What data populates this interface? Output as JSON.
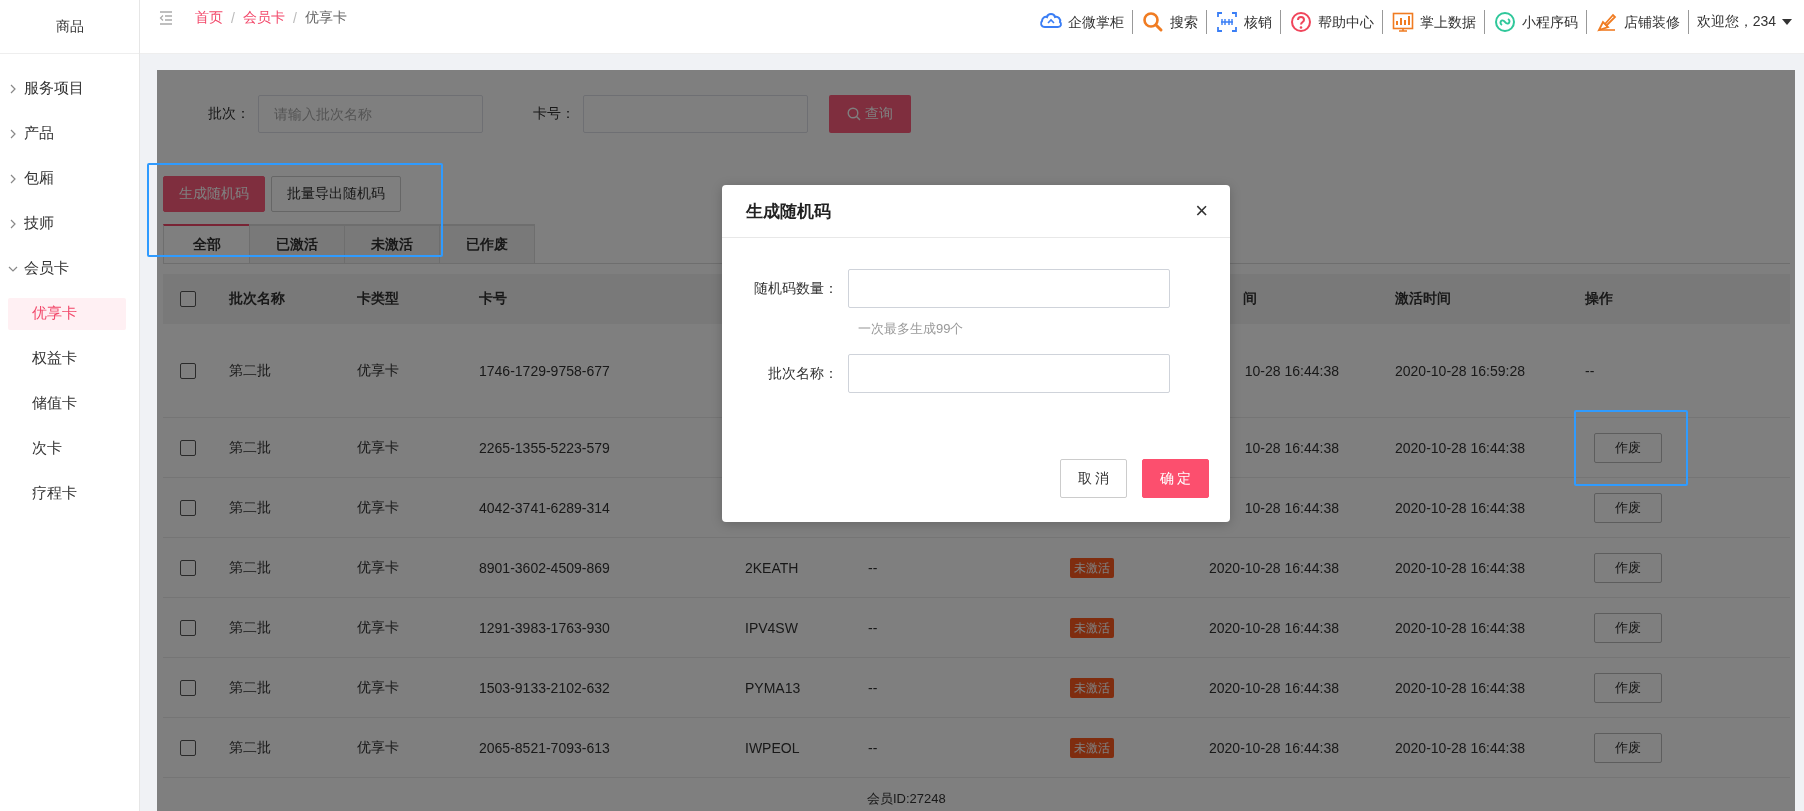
{
  "sidebar": {
    "title": "商品",
    "items": [
      {
        "label": "服务项目",
        "expanded": false
      },
      {
        "label": "产品",
        "expanded": false
      },
      {
        "label": "包厢",
        "expanded": false
      },
      {
        "label": "技师",
        "expanded": false
      },
      {
        "label": "会员卡",
        "expanded": true,
        "children": [
          {
            "label": "优享卡",
            "selected": true
          },
          {
            "label": "权益卡",
            "selected": false
          },
          {
            "label": "储值卡",
            "selected": false
          },
          {
            "label": "次卡",
            "selected": false
          },
          {
            "label": "疗程卡",
            "selected": false
          }
        ]
      }
    ]
  },
  "breadcrumb": [
    {
      "label": "首页",
      "current": false
    },
    {
      "separator": "/",
      "label": "会员卡",
      "current": false
    },
    {
      "separator": "/",
      "label": "优享卡",
      "current": true
    }
  ],
  "header_links": [
    {
      "label": "企微掌柜",
      "kind": "cloud"
    },
    {
      "label": "搜索",
      "kind": "search"
    },
    {
      "label": "核销",
      "kind": "scan"
    },
    {
      "label": "帮助中心",
      "kind": "help"
    },
    {
      "label": "掌上数据",
      "kind": "chart"
    },
    {
      "label": "小程序码",
      "kind": "link"
    },
    {
      "label": "店铺装修",
      "kind": "brush"
    }
  ],
  "user_menu": {
    "label": "欢迎您，234"
  },
  "filters": [
    {
      "label": "批次：",
      "placeholder": "请输入批次名称"
    },
    {
      "label": "卡号："
    }
  ],
  "search_button": "查询",
  "actions": [
    {
      "label": "生成随机码",
      "kind": "primary"
    },
    {
      "label": "批量导出随机码",
      "kind": "default"
    }
  ],
  "tabs": [
    {
      "label": "全部",
      "selected": true
    },
    {
      "label": "已激活",
      "selected": false
    },
    {
      "label": "未激活",
      "selected": false
    },
    {
      "label": "已作废",
      "selected": false
    }
  ],
  "table": {
    "header": {
      "checked": false,
      "batch": "批次名称",
      "card_type": "卡类型",
      "card_no": "卡号",
      "created": "间",
      "activated": "激活时间",
      "action": "操作"
    },
    "rows": [
      {
        "checked": false,
        "batch": "第二批",
        "card_type": "优享卡",
        "card_no": "1746-1729-9758-677",
        "created": "10-28 16:44:38",
        "activated": "2020-10-28 16:59:28",
        "action": {
          "kind": "text",
          "label": "--"
        }
      },
      {
        "checked": false,
        "batch": "第二批",
        "card_type": "优享卡",
        "card_no": "2265-1355-5223-579",
        "created": "10-28 16:44:38",
        "activated": "2020-10-28 16:44:38",
        "action": {
          "kind": "button",
          "label": "作废"
        }
      },
      {
        "checked": false,
        "batch": "第二批",
        "card_type": "优享卡",
        "card_no": "4042-3741-6289-314",
        "created": "10-28 16:44:38",
        "activated": "2020-10-28 16:44:38",
        "action": {
          "kind": "button",
          "label": "作废"
        }
      },
      {
        "checked": false,
        "batch": "第二批",
        "card_type": "优享卡",
        "card_no": "8901-3602-4509-869",
        "column_5": "2KEATH",
        "column_6": "--",
        "column_7": "未激活",
        "created": "2020-10-28 16:44:38",
        "activated": "2020-10-28 16:44:38",
        "action": {
          "kind": "button",
          "label": "作废"
        }
      },
      {
        "checked": false,
        "batch": "第二批",
        "card_type": "优享卡",
        "card_no": "1291-3983-1763-930",
        "column_5": "IPV4SW",
        "column_6": "--",
        "column_7": "未激活",
        "created": "2020-10-28 16:44:38",
        "activated": "2020-10-28 16:44:38",
        "action": {
          "kind": "button",
          "label": "作废"
        }
      },
      {
        "checked": false,
        "batch": "第二批",
        "card_type": "优享卡",
        "card_no": "1503-9133-2102-632",
        "column_5": "PYMA13",
        "column_6": "--",
        "column_7": "未激活",
        "created": "2020-10-28 16:44:38",
        "activated": "2020-10-28 16:44:38",
        "action": {
          "kind": "button",
          "label": "作废"
        }
      },
      {
        "checked": false,
        "batch": "第二批",
        "card_type": "优享卡",
        "card_no": "2065-8521-7093-613",
        "column_5": "IWPEOL",
        "column_6": "--",
        "column_7": "未激活",
        "created": "2020-10-28 16:44:38",
        "activated": "2020-10-28 16:44:38",
        "action": {
          "kind": "button",
          "label": "作废"
        }
      }
    ],
    "footer": "会员ID:27248"
  },
  "dialog": {
    "title": "生成随机码",
    "close": "×",
    "fields": [
      {
        "label": "随机码数量：",
        "hint": "一次最多生成99个"
      },
      {
        "label": "批次名称："
      }
    ],
    "buttons": [
      {
        "label": "取 消",
        "kind": "default"
      },
      {
        "label": "确 定",
        "kind": "primary"
      }
    ]
  }
}
